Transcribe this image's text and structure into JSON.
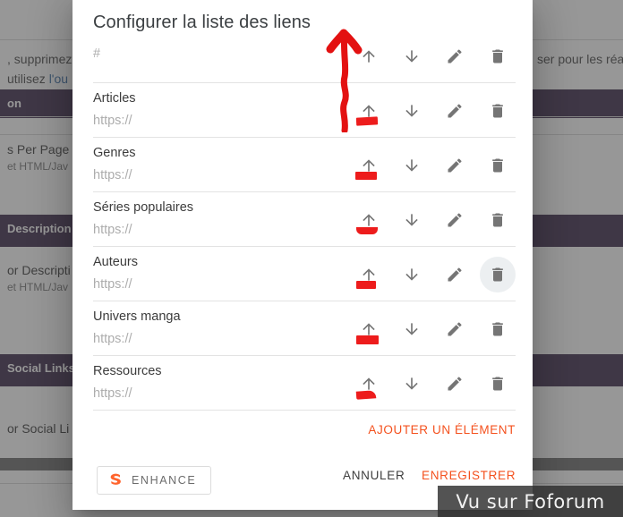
{
  "dialog": {
    "title": "Configurer la liste des liens",
    "header_row_label": "#",
    "rows": [
      {
        "label": "Articles",
        "url": "https://"
      },
      {
        "label": "Genres",
        "url": "https://"
      },
      {
        "label": "Séries populaires",
        "url": "https://"
      },
      {
        "label": "Auteurs",
        "url": "https://"
      },
      {
        "label": "Univers manga",
        "url": "https://"
      },
      {
        "label": "Ressources",
        "url": "https://"
      }
    ],
    "row_actions": {
      "move_up": "move-up",
      "move_down": "move-down",
      "edit": "edit",
      "delete": "delete"
    },
    "add_item_label": "AJOUTER UN ÉLÉMENT",
    "footer": {
      "enhance_label": "ENHANCE",
      "cancel_label": "ANNULER",
      "save_label": "ENREGISTRER"
    },
    "colors": {
      "accent": "#f4511e",
      "icon": "#757575",
      "annotation": "#ed1c1c",
      "title": "#3c4043"
    }
  },
  "scrollbar": {
    "up_arrow": "scroll-up",
    "down_arrow": "scroll-down"
  },
  "background": {
    "lines": [
      ", supprimez",
      "utilisez l'ou",
      "ser pour les réa"
    ],
    "link_text": "l'ou",
    "sections": [
      {
        "heading": "on"
      },
      {
        "heading": "Description"
      },
      {
        "heading": "Social Links"
      }
    ],
    "fields": [
      {
        "label": "s Per Page",
        "sub": "et HTML/Jav"
      },
      {
        "label": "or Descripti",
        "sub": "et HTML/Jav"
      },
      {
        "label": "or Social Li",
        "sub": ""
      }
    ]
  },
  "watermark": {
    "text": "Vu sur Foforum"
  }
}
